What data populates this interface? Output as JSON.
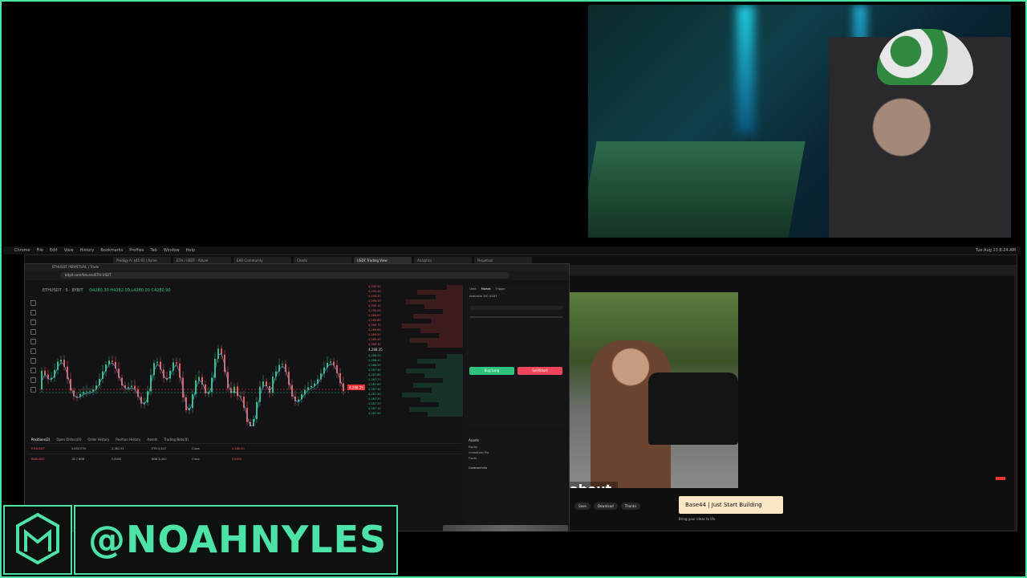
{
  "stream": {
    "handle": "@NOAHNYLES",
    "accent_color": "#4de3a6"
  },
  "menubar": {
    "items": [
      "Chrome",
      "File",
      "Edit",
      "View",
      "History",
      "Bookmarks",
      "Profiles",
      "Tab",
      "Window",
      "Help"
    ],
    "clock": "Tue Aug 13  8:24 AM"
  },
  "browser": {
    "tabs": [
      "Prodigy A: $45 91 | Acme",
      "ETH / USDT - Advan",
      "EXO Community",
      "Charts",
      "USDT Trading View",
      "Analytics",
      "Perpetual"
    ],
    "url": "bitpit.com/futures/ETH-USDT"
  },
  "trading": {
    "window_title": "ETHUSDT PERPETUAL | Trade",
    "symbol": "ETHUSDT · 5 · BYBIT",
    "ohlc": "O4280.30 H4282.00 L4280.00 C4280.90",
    "price_tag": "4,288.25",
    "orderbook": {
      "asks": [
        "4,290.50",
        "4,290.40",
        "4,290.30",
        "4,290.20",
        "4,290.10",
        "4,290.00",
        "4,289.90",
        "4,289.80",
        "4,289.70",
        "4,289.60",
        "4,289.50",
        "4,289.40",
        "4,289.30"
      ],
      "mid": "4,288.35",
      "bids": [
        "4,288.20",
        "4,288.10",
        "4,288.00",
        "4,287.90",
        "4,287.80",
        "4,287.70",
        "4,287.60",
        "4,287.50",
        "4,287.40",
        "4,287.30",
        "4,287.20",
        "4,287.10",
        "4,287.00"
      ]
    },
    "order_form": {
      "tabs": [
        "Limit",
        "Market",
        "Trigger"
      ],
      "buy_label": "Buy/Long",
      "sell_label": "Sell/Short",
      "available": "Available 200 USDT"
    },
    "positions": {
      "tabs": [
        "Positions(2)",
        "Open Orders(0)",
        "Order History",
        "Position History",
        "Assets",
        "Trading Bots(0)"
      ],
      "rows": [
        [
          "ETHUSDT",
          "5.850 ETH",
          "4,282.91",
          "ETH 5,847",
          "Cross",
          "4,289.50"
        ],
        [
          "BNBUSDT",
          "18.7 BNB",
          "0.8400",
          "BNB 8,400",
          "Cross",
          "0.8400"
        ]
      ]
    },
    "assets": {
      "title": "Assets",
      "lines": [
        "Equity",
        "Unrealized PnL",
        "Funds",
        "Contract Info"
      ]
    }
  },
  "youtube": {
    "caption": "about,",
    "actions": [
      "Save",
      "Download",
      "Thanks"
    ],
    "ad_title": "Base44 | Just Start Building",
    "ad_sub": "Bring your ideas to life"
  }
}
